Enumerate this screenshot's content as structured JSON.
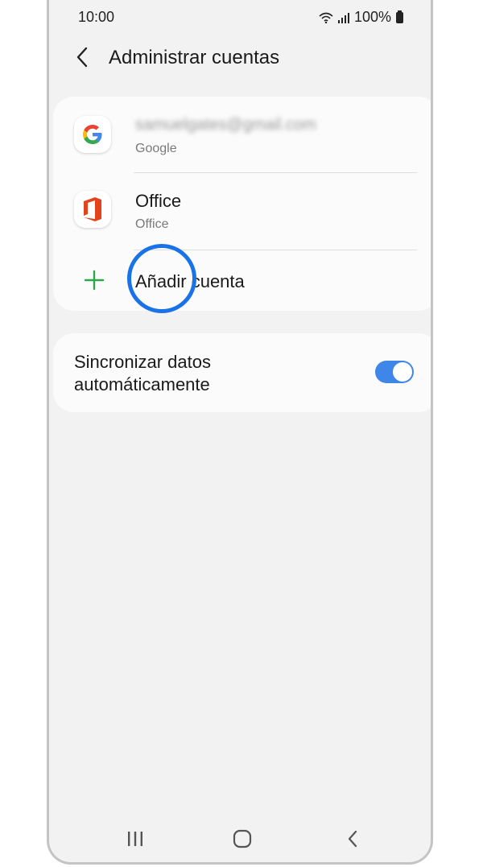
{
  "status_bar": {
    "time": "10:00",
    "battery": "100%",
    "icons": [
      "wifi-icon",
      "signal-icon",
      "battery-icon"
    ]
  },
  "header": {
    "title": "Administrar cuentas",
    "back_icon": "chevron-left-icon"
  },
  "accounts": [
    {
      "title": "samuelgates@gmail.com",
      "subtitle": "Google",
      "icon": "google-icon"
    },
    {
      "title": "Office",
      "subtitle": "Office",
      "icon": "office-icon"
    }
  ],
  "add_account": {
    "label": "Añadir cuenta",
    "icon": "plus-icon"
  },
  "sync": {
    "label": "Sincronizar datos automáticamente",
    "enabled": true
  },
  "nav_bar": {
    "icons": [
      "recents-icon",
      "home-icon",
      "back-icon"
    ]
  },
  "colors": {
    "accent": "#1a72e8",
    "toggle": "#3e86e8",
    "office": "#e3441c",
    "plus": "#2aa84a"
  }
}
